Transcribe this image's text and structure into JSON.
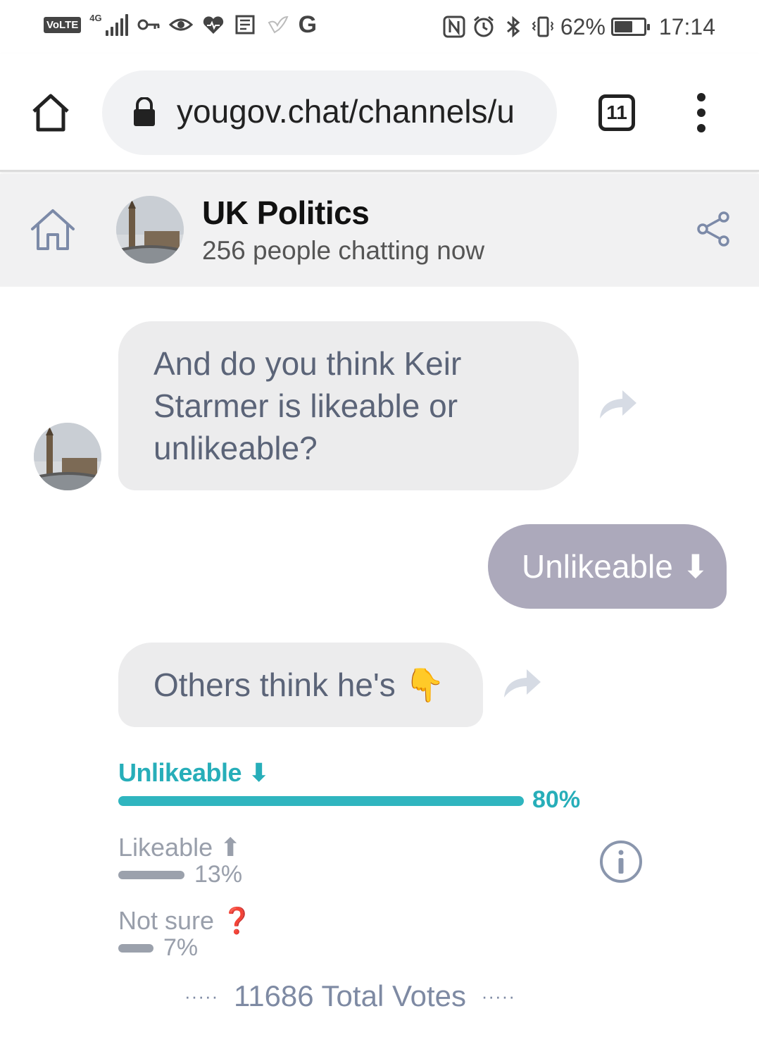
{
  "status_bar": {
    "volte": "VoLTE",
    "network": "4G",
    "g_letter": "G",
    "battery_pct": "62%",
    "battery_level": 0.62,
    "time": "17:14",
    "icons": [
      "signal-icon",
      "key-icon",
      "eye-icon",
      "heart-icon",
      "news-icon",
      "bird-icon",
      "google-icon",
      "nfc-icon",
      "alarm-icon",
      "bluetooth-icon",
      "vibrate-icon",
      "battery-icon"
    ]
  },
  "browser": {
    "url": "yougov.chat/channels/u",
    "tab_count": "11"
  },
  "channel": {
    "title": "UK Politics",
    "subtitle": "256 people chatting now"
  },
  "chat": {
    "question": "And do you think Keir Starmer is likeable or unlikeable?",
    "answer": "Unlikeable ⬇",
    "others": "Others think he's 👇"
  },
  "poll": {
    "options": [
      {
        "label": "Unlikeable ⬇",
        "pct": "80%",
        "value": 80
      },
      {
        "label": "Likeable ⬆",
        "pct": "13%",
        "value": 13
      },
      {
        "label": "Not sure ❓",
        "pct": "7%",
        "value": 7
      }
    ],
    "total_votes": "11686 Total Votes",
    "dots": "·····"
  },
  "colors": {
    "accent": "#2fb5bf",
    "answer_bubble": "#aca9bb",
    "incoming_bubble": "#ececed",
    "muted_text": "#999fab"
  }
}
